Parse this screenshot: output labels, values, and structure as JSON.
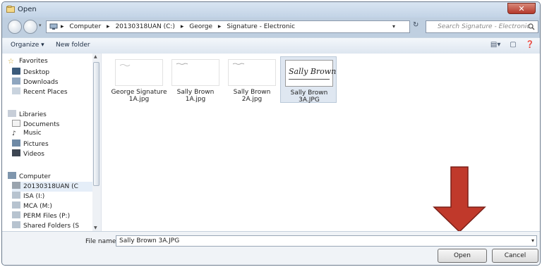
{
  "window": {
    "title": "Open",
    "close_glyph": "✕"
  },
  "address_bar": {
    "crumbs": [
      "Computer",
      "20130318UAN (C:)",
      "George",
      "Signature - Electronic"
    ],
    "separator": "▸",
    "refresh_glyph": "↻"
  },
  "search": {
    "placeholder": "Search Signature - Electronic"
  },
  "toolbar": {
    "organize_label": "Organize ▾",
    "new_folder_label": "New folder"
  },
  "nav_pane": {
    "favorites": {
      "header": "Favorites",
      "items": [
        "Desktop",
        "Downloads",
        "Recent Places"
      ]
    },
    "libraries": {
      "header": "Libraries",
      "items": [
        "Documents",
        "Music",
        "Pictures",
        "Videos"
      ]
    },
    "computer": {
      "header": "Computer",
      "items": [
        "20130318UAN (C",
        "ISA (I:)",
        "MCA (M:)",
        "PERM Files (P:)",
        "Shared Folders (S"
      ]
    }
  },
  "files": [
    {
      "name_line1": "George Signature",
      "name_line2": "1A.jpg",
      "selected": false
    },
    {
      "name_line1": "Sally Brown",
      "name_line2": "1A.jpg",
      "selected": false
    },
    {
      "name_line1": "Sally Brown",
      "name_line2": "2A.jpg",
      "selected": false
    },
    {
      "name_line1": "Sally Brown",
      "name_line2": "3A.JPG",
      "selected": true,
      "thumb_text": "Sally Brown"
    }
  ],
  "file_name": {
    "label": "File name:",
    "value": "Sally Brown 3A.JPG"
  },
  "buttons": {
    "open": "Open",
    "cancel": "Cancel"
  },
  "colors": {
    "arrow": "#c0392b",
    "selection": "#dfe7f1",
    "frame": "#bfcfe0"
  }
}
